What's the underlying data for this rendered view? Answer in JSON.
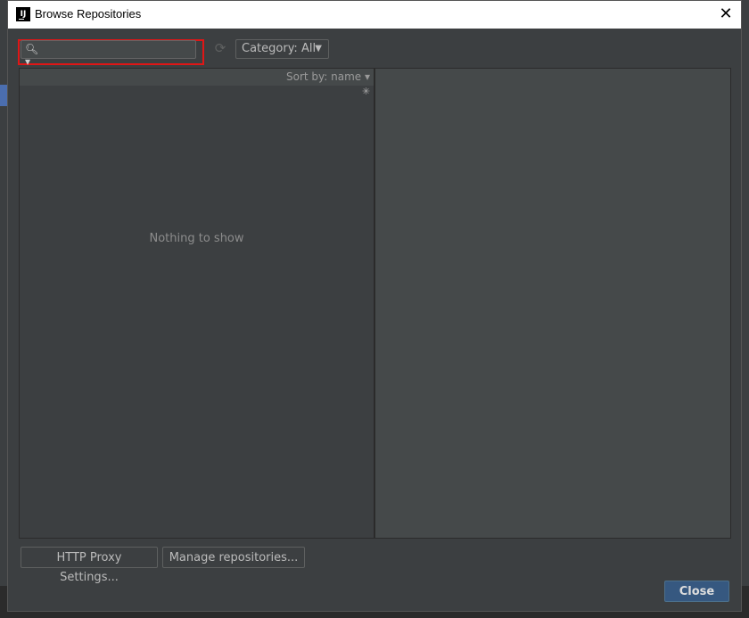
{
  "window": {
    "title": "Browse Repositories",
    "app_icon_text": "IJ"
  },
  "toolbar": {
    "search_value": "",
    "search_placeholder": "",
    "category_label": "Category: All"
  },
  "list": {
    "sort_label": "Sort by: name ▾",
    "empty_text": "Nothing to show"
  },
  "footer": {
    "proxy_button": "HTTP Proxy Settings...",
    "manage_button": "Manage repositories...",
    "close_button": "Close"
  },
  "colors": {
    "dialog_bg": "#3c3f41",
    "highlight": "#e01616",
    "primary_button": "#365880"
  },
  "icons": {
    "app": "intellij-icon",
    "search": "search-icon",
    "refresh": "refresh-icon",
    "dropdown": "chevron-down-icon",
    "loading": "spinner-icon",
    "close": "close-icon"
  }
}
